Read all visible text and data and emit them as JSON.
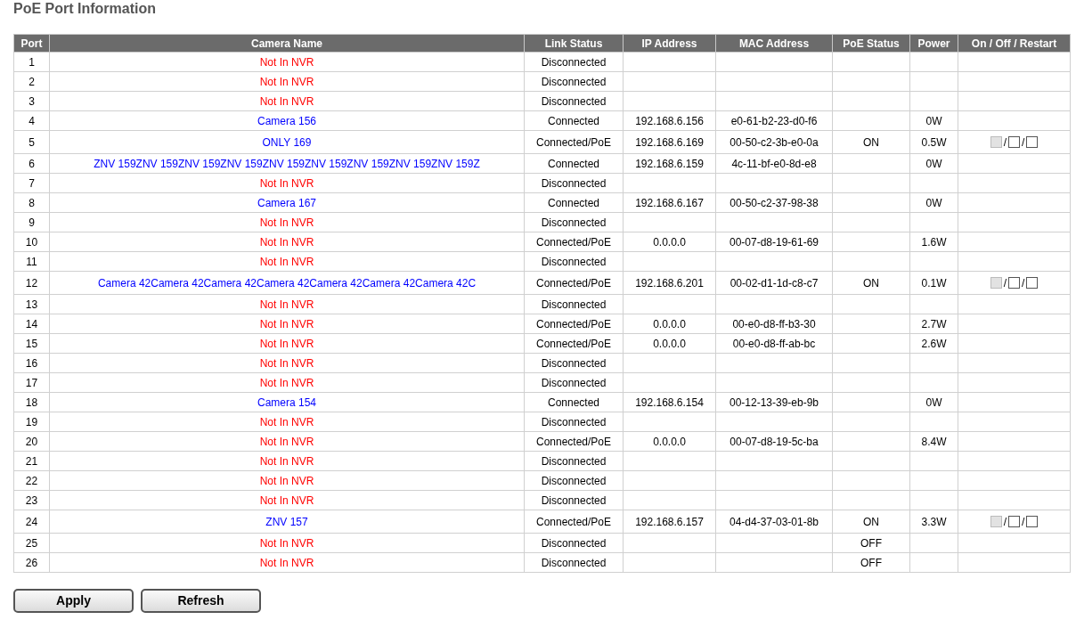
{
  "title": "PoE Port Information",
  "table": {
    "columns": [
      "Port",
      "Camera Name",
      "Link Status",
      "IP Address",
      "MAC Address",
      "PoE Status",
      "Power",
      "On / Off / Restart"
    ],
    "rows": [
      {
        "port": "1",
        "name": "Not In NVR",
        "color": "#ff0000",
        "link": "Disconnected"
      },
      {
        "port": "2",
        "name": "Not In NVR",
        "color": "#ff0000",
        "link": "Disconnected"
      },
      {
        "port": "3",
        "name": "Not In NVR",
        "color": "#ff0000",
        "link": "Disconnected"
      },
      {
        "port": "4",
        "name": "Camera 156",
        "color": "#0000ff",
        "link": "Connected",
        "ip": "192.168.6.156",
        "mac": "e0-61-b2-23-d0-f6",
        "power": "0W"
      },
      {
        "port": "5",
        "name": "ONLY 169",
        "color": "#0000ff",
        "link": "Connected/PoE",
        "ip": "192.168.6.169",
        "mac": "00-50-c2-3b-e0-0a",
        "poe": "ON",
        "power": "0.5W",
        "controls": [
          {
            "kind": "checkbox",
            "checked": false,
            "disabled": true
          },
          {
            "kind": "separator",
            "text": "/"
          },
          {
            "kind": "checkbox",
            "checked": false,
            "disabled": false
          },
          {
            "kind": "separator",
            "text": "/"
          },
          {
            "kind": "checkbox",
            "checked": false,
            "disabled": false
          }
        ]
      },
      {
        "port": "6",
        "name": "ZNV 159ZNV 159ZNV 159ZNV 159ZNV 159ZNV 159ZNV 159ZNV 159ZNV 159Z",
        "color": "#0000ff",
        "link": "Connected",
        "ip": "192.168.6.159",
        "mac": "4c-11-bf-e0-8d-e8",
        "power": "0W"
      },
      {
        "port": "7",
        "name": "Not In NVR",
        "color": "#ff0000",
        "link": "Disconnected"
      },
      {
        "port": "8",
        "name": "Camera 167",
        "color": "#0000ff",
        "link": "Connected",
        "ip": "192.168.6.167",
        "mac": "00-50-c2-37-98-38",
        "power": "0W"
      },
      {
        "port": "9",
        "name": "Not In NVR",
        "color": "#ff0000",
        "link": "Disconnected"
      },
      {
        "port": "10",
        "name": "Not In NVR",
        "color": "#ff0000",
        "link": "Connected/PoE",
        "ip": "0.0.0.0",
        "mac": "00-07-d8-19-61-69",
        "power": "1.6W"
      },
      {
        "port": "11",
        "name": "Not In NVR",
        "color": "#ff0000",
        "link": "Disconnected"
      },
      {
        "port": "12",
        "name": "Camera 42Camera 42Camera 42Camera 42Camera 42Camera 42Camera 42C",
        "color": "#0000ff",
        "link": "Connected/PoE",
        "ip": "192.168.6.201",
        "mac": "00-02-d1-1d-c8-c7",
        "poe": "ON",
        "power": "0.1W",
        "controls": [
          {
            "kind": "checkbox",
            "checked": false,
            "disabled": true
          },
          {
            "kind": "separator",
            "text": "/"
          },
          {
            "kind": "checkbox",
            "checked": false,
            "disabled": false
          },
          {
            "kind": "separator",
            "text": "/"
          },
          {
            "kind": "checkbox",
            "checked": false,
            "disabled": false
          }
        ]
      },
      {
        "port": "13",
        "name": "Not In NVR",
        "color": "#ff0000",
        "link": "Disconnected"
      },
      {
        "port": "14",
        "name": "Not In NVR",
        "color": "#ff0000",
        "link": "Connected/PoE",
        "ip": "0.0.0.0",
        "mac": "00-e0-d8-ff-b3-30",
        "power": "2.7W"
      },
      {
        "port": "15",
        "name": "Not In NVR",
        "color": "#ff0000",
        "link": "Connected/PoE",
        "ip": "0.0.0.0",
        "mac": "00-e0-d8-ff-ab-bc",
        "power": "2.6W"
      },
      {
        "port": "16",
        "name": "Not In NVR",
        "color": "#ff0000",
        "link": "Disconnected"
      },
      {
        "port": "17",
        "name": "Not In NVR",
        "color": "#ff0000",
        "link": "Disconnected"
      },
      {
        "port": "18",
        "name": "Camera 154",
        "color": "#0000ff",
        "link": "Connected",
        "ip": "192.168.6.154",
        "mac": "00-12-13-39-eb-9b",
        "power": "0W"
      },
      {
        "port": "19",
        "name": "Not In NVR",
        "color": "#ff0000",
        "link": "Disconnected"
      },
      {
        "port": "20",
        "name": "Not In NVR",
        "color": "#ff0000",
        "link": "Connected/PoE",
        "ip": "0.0.0.0",
        "mac": "00-07-d8-19-5c-ba",
        "power": "8.4W"
      },
      {
        "port": "21",
        "name": "Not In NVR",
        "color": "#ff0000",
        "link": "Disconnected"
      },
      {
        "port": "22",
        "name": "Not In NVR",
        "color": "#ff0000",
        "link": "Disconnected"
      },
      {
        "port": "23",
        "name": "Not In NVR",
        "color": "#ff0000",
        "link": "Disconnected"
      },
      {
        "port": "24",
        "name": "ZNV 157",
        "color": "#0000ff",
        "link": "Connected/PoE",
        "ip": "192.168.6.157",
        "mac": "04-d4-37-03-01-8b",
        "poe": "ON",
        "power": "3.3W",
        "controls": [
          {
            "kind": "checkbox",
            "checked": false,
            "disabled": true
          },
          {
            "kind": "separator",
            "text": "/"
          },
          {
            "kind": "checkbox",
            "checked": false,
            "disabled": false
          },
          {
            "kind": "separator",
            "text": "/"
          },
          {
            "kind": "checkbox",
            "checked": false,
            "disabled": false
          }
        ]
      },
      {
        "port": "25",
        "name": "Not In NVR",
        "color": "#ff0000",
        "link": "Disconnected",
        "poe": "OFF"
      },
      {
        "port": "26",
        "name": "Not In NVR",
        "color": "#ff0000",
        "link": "Disconnected",
        "poe": "OFF"
      }
    ]
  },
  "buttons": [
    "Apply",
    "Refresh"
  ]
}
